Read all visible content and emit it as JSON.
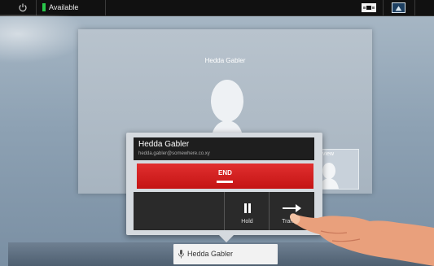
{
  "status_bar": {
    "power_icon": "power-icon",
    "availability": "Available",
    "availability_color": "#29c74a",
    "layout_icon": "layout-icon",
    "selfview_icon": "selfview-icon"
  },
  "remote": {
    "name": "Hedda Gabler"
  },
  "selfview": {
    "label": "Selfview"
  },
  "call_popup": {
    "name": "Hedda Gabler",
    "address": "hedda.gabler@somewhere.co.xy",
    "end_label": "END",
    "end_color": "#d42020",
    "actions": [
      {
        "label": "Hold",
        "icon": "pause-icon"
      },
      {
        "label": "Transfer",
        "icon": "transfer-arrow-icon"
      }
    ]
  },
  "call_pill": {
    "name": "Hedda Gabler",
    "icon": "microphone-icon"
  }
}
